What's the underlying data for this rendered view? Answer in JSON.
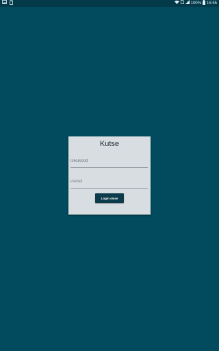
{
  "status_bar": {
    "battery": "100%",
    "time": "15:55",
    "icons": [
      "image-icon",
      "clipboard-icon",
      "wifi-icon",
      "sim-icon",
      "signal-icon",
      "battery-icon"
    ]
  },
  "dialog": {
    "title": "Kutse",
    "username_placeholder": "Isikukood",
    "username_value": "",
    "password_placeholder": "Parool",
    "password_value": "",
    "login_button": "Login sisse"
  },
  "colors": {
    "background": "#024a5e",
    "dialog": "#d8dde1",
    "button": "#0c3b4b"
  }
}
